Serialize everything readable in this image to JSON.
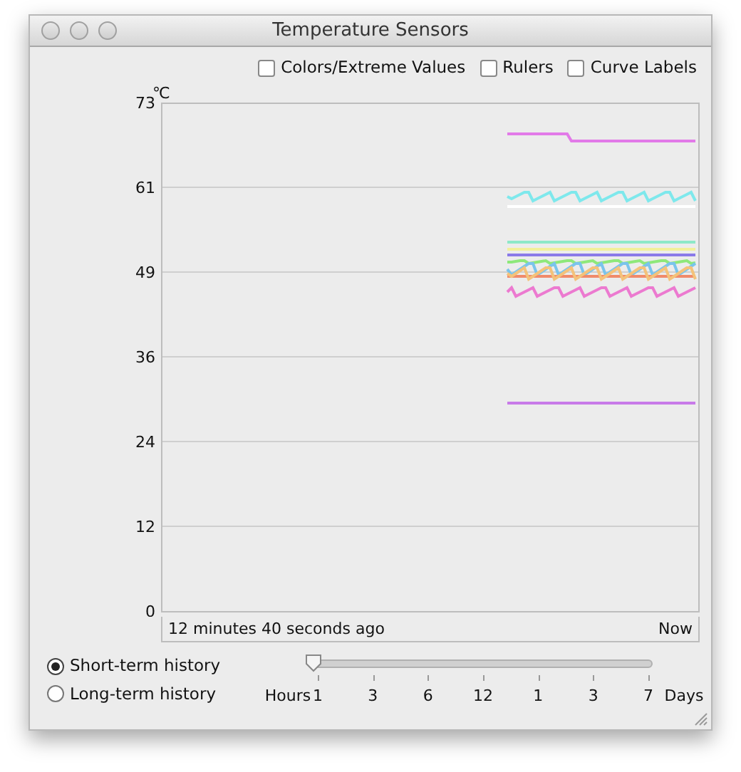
{
  "window": {
    "title": "Temperature Sensors"
  },
  "options": [
    {
      "label": "Colors/Extreme Values",
      "checked": false
    },
    {
      "label": "Rulers",
      "checked": false
    },
    {
      "label": "Curve Labels",
      "checked": false
    }
  ],
  "chart": {
    "unit": "℃",
    "y_ticks": [
      "73",
      "61",
      "49",
      "36",
      "24",
      "12",
      "0"
    ],
    "start_label": "12 minutes 40 seconds ago",
    "end_label": "Now"
  },
  "history": [
    {
      "label": "Short-term history",
      "selected": true
    },
    {
      "label": "Long-term history",
      "selected": false
    }
  ],
  "slider": {
    "level": 0,
    "start_unit": "Hours",
    "end_unit": "Days",
    "ticks": [
      "1",
      "3",
      "6",
      "12",
      "1",
      "3",
      "7"
    ]
  }
}
